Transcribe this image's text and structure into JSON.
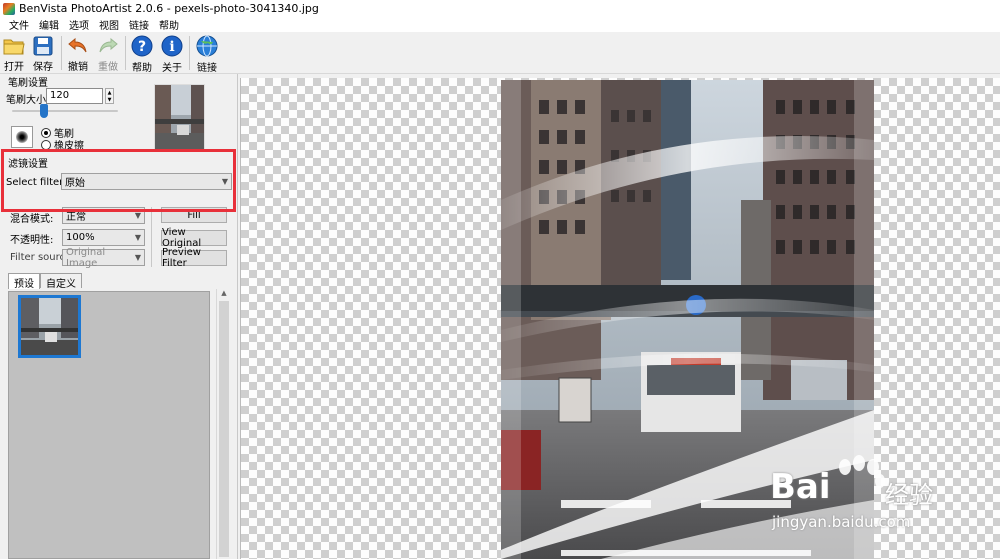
{
  "window": {
    "title": "BenVista PhotoArtist 2.0.6 - pexels-photo-3041340.jpg"
  },
  "menu": [
    "文件",
    "编辑",
    "选项",
    "视图",
    "链接",
    "帮助"
  ],
  "toolbar": {
    "open": "打开",
    "save": "保存",
    "undo": "撤销",
    "redo": "重做",
    "help": "帮助",
    "about": "关于",
    "link": "链接"
  },
  "brush": {
    "group_label": "笔刷设置",
    "size_label": "笔刷大小:",
    "size_value": "120",
    "slider_level": 0.3,
    "mode_brush": "笔刷",
    "mode_eraser": "橡皮擦",
    "selected_mode": "笔刷"
  },
  "filter": {
    "group_label": "滤镜设置",
    "select_label": "Select filter:",
    "selected": "原始"
  },
  "blend": {
    "mode_label": "混合模式:",
    "mode_value": "正常",
    "opacity_label": "不透明性:",
    "opacity_value": "100%",
    "source_label": "Filter source:",
    "source_value": "Original Image"
  },
  "buttons": {
    "fill": "Fill",
    "view_original": "View Original",
    "preview_filter": "Preview Filter"
  },
  "tabs": {
    "presets": "预设",
    "custom": "自定义",
    "active": "预设"
  },
  "watermark": {
    "brand": "Bai",
    "brand_tail": "经验",
    "url": "jingyan.baidu.com"
  },
  "colors": {
    "highlight": "#e8303a",
    "accent": "#1e78d2",
    "help_icon": "#1f64c8"
  },
  "icons": {
    "open": "folder-icon",
    "save": "floppy-disk-icon",
    "undo": "undo-arrow-icon",
    "redo": "redo-arrow-icon",
    "help": "question-mark-icon",
    "about": "info-icon",
    "link": "globe-icon"
  }
}
